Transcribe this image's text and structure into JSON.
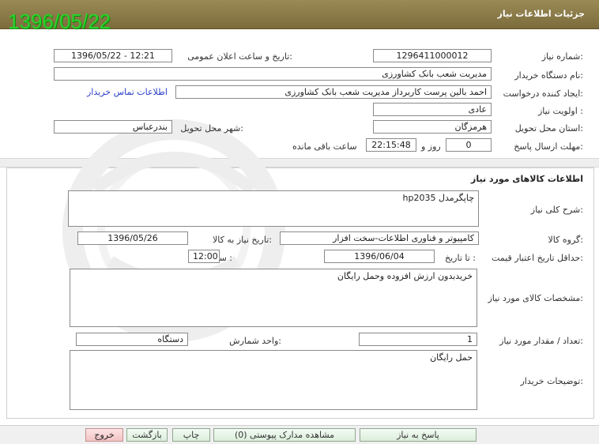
{
  "header": {
    "title": "جزئیات اطلاعات نیاز",
    "date_stamp": "1396/05/22"
  },
  "need": {
    "number_label": "شماره نیاز:",
    "number_value": "1296411000012",
    "announce_label": "تاریخ و ساعت اعلان عمومی:",
    "announce_value": "1396/05/22 - 12:21",
    "buyer_org_label": "نام دستگاه خریدار:",
    "buyer_org_value": "مدیریت شعب بانک کشاورزی",
    "creator_label": "ایجاد کننده درخواست:",
    "creator_value": "احمد بالین پرست  کاربرداز مدیریت شعب بانک کشاورزی",
    "contact_link": "اطلاعات تماس خریدار",
    "priority_label": "اولویت نیاز :",
    "priority_value": "عادی",
    "province_label": "استان محل تحویل:",
    "province_value": "هرمزگان",
    "city_label": "شهر محل تحویل:",
    "city_value": "بندرعباس",
    "deadline_label": "مهلت ارسال پاسخ:",
    "deadline_days": "0",
    "days_word": "روز و",
    "deadline_time": "22:15:48",
    "remaining_text": "ساعت باقی مانده"
  },
  "goods": {
    "section_title": "اطلاعات کالاهای مورد نیاز",
    "desc_label": "شرح کلی نیاز:",
    "desc_value": "چاپگرمدل hp2035",
    "group_label": "گروه کالا:",
    "group_value": "کامپیوتر و فناوری اطلاعات-سخت افزار",
    "need_date_label": "تاریخ نیاز به کالا:",
    "need_date_value": "1396/05/26",
    "price_valid_label": "حداقل تاریخ اعتبار قیمت:",
    "to_date_label": "تا تاریخ :",
    "to_date_value": "1396/06/04",
    "time_label": "ساعت :",
    "time_value": "12:00",
    "specs_label": "مشخصات کالای مورد نیاز:",
    "specs_value": "خریدبدون ارزش افزوده وحمل رایگان",
    "qty_label": "تعداد / مقدار مورد نیاز:",
    "qty_value": "1",
    "unit_label": "واحد شمارش:",
    "unit_value": "دستگاه",
    "buyer_notes_label": "توضیحات خریدار:",
    "buyer_notes_value": "حمل رایگان"
  },
  "buttons": {
    "respond": "پاسخ به نیاز",
    "attachments": "مشاهده مدارک پیوستی (0)",
    "print": "چاپ",
    "back": "بازگشت",
    "exit": "خروج"
  },
  "colors": {
    "title_bar": "#8a7a48",
    "stamp": "#2bd22b",
    "link": "#2a3ec8",
    "exit_button": "#f3c2c2"
  }
}
